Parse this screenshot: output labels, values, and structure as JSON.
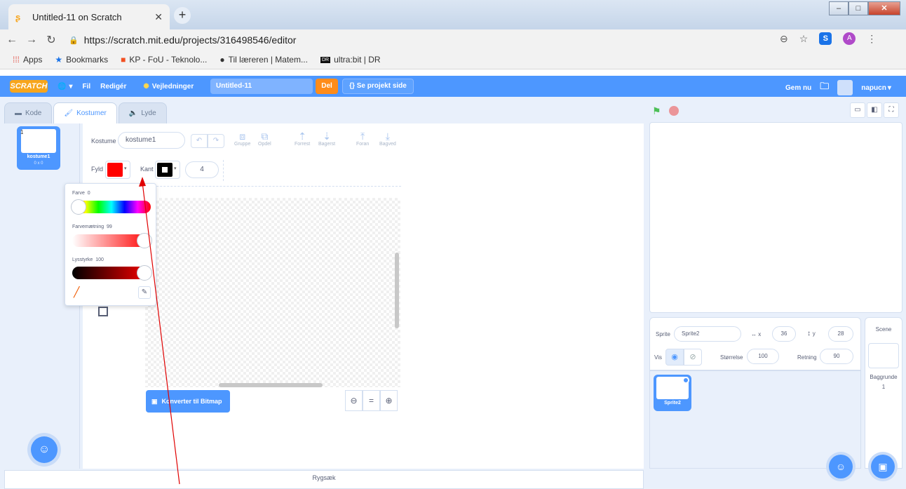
{
  "browser": {
    "tab_title": "Untitled-11 on Scratch",
    "url": "https://scratch.mit.edu/projects/316498546/editor",
    "avatar_letter": "A",
    "skype_letter": "S"
  },
  "bookmarks": [
    {
      "label": "Apps",
      "icon": "apps-grid-icon"
    },
    {
      "label": "Bookmarks",
      "icon": "star-icon"
    },
    {
      "label": "KP - FoU - Teknolo...",
      "icon": "windows-logo-icon"
    },
    {
      "label": "Til læreren | Matem...",
      "icon": "globe-icon"
    },
    {
      "label": "ultra:bit | DR",
      "icon": "dr-logo-icon"
    }
  ],
  "menubar": {
    "logo": "SCRATCH",
    "file": "Fil",
    "edit": "Redigér",
    "tutorials": "Vejledninger",
    "project_title": "Untitled-11",
    "share": "Del",
    "see_project": "Se projekt side",
    "save_now": "Gem nu",
    "username": "napucn"
  },
  "tabs": {
    "code": "Kode",
    "costumes": "Kostumer",
    "sounds": "Lyde"
  },
  "costume_list": [
    {
      "index": "1",
      "name": "kostume1",
      "size": "0 x 0"
    }
  ],
  "paint": {
    "costume_label": "Kostume",
    "costume_name": "kostume1",
    "group": "Gruppe",
    "ungroup": "Opdel",
    "forward": "Forrest",
    "backward": "Bagerst",
    "front": "Foran",
    "back": "Bagved",
    "fill_label": "Fyld",
    "outline_label": "Kant",
    "outline_width": "4",
    "fill_color": "#ff0000",
    "outline_color": "#000000",
    "convert_button": "Konverter til Bitmap"
  },
  "color_picker": {
    "color_label": "Farve",
    "color_value": "0",
    "saturation_label": "Farvemætning",
    "saturation_value": "99",
    "brightness_label": "Lysstyrke",
    "brightness_value": "100"
  },
  "sprite_info": {
    "sprite_label": "Sprite",
    "sprite_name": "Sprite2",
    "x_label": "x",
    "x_value": "36",
    "y_label": "y",
    "y_value": "28",
    "show_label": "Vis",
    "size_label": "Størrelse",
    "size_value": "100",
    "direction_label": "Retning",
    "direction_value": "90"
  },
  "sprites": [
    {
      "name": "Sprite2"
    }
  ],
  "scene": {
    "label": "Scene",
    "backdrops_label": "Baggrunde",
    "backdrops_count": "1"
  },
  "backpack": {
    "label": "Rygsæk"
  }
}
